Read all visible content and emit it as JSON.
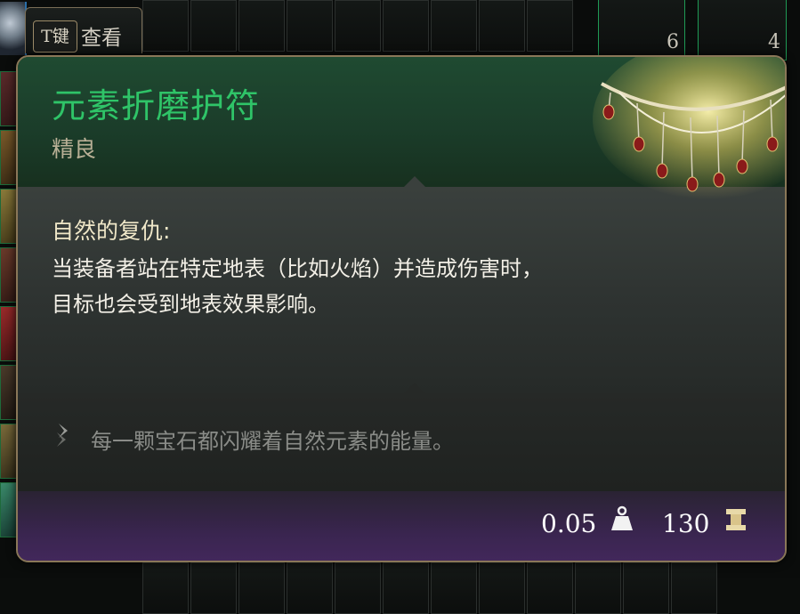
{
  "hint": {
    "key": "T键",
    "action": "查看"
  },
  "background_slots": {
    "counts": [
      "6",
      "4"
    ]
  },
  "item": {
    "name": "元素折磨护符",
    "rarity": "精良",
    "name_color": "#2fc468"
  },
  "passive": {
    "title": "自然的复仇:",
    "description": "当装备者站在特定地表（比如火焰）并造成伤害时，目标也会受到地表效果影响。"
  },
  "flavor": {
    "text": "每一颗宝石都闪耀着自然元素的能量。"
  },
  "footer": {
    "weight": "0.05",
    "value": "130",
    "weight_icon": "weight-icon",
    "gold_icon": "gold-icon"
  }
}
